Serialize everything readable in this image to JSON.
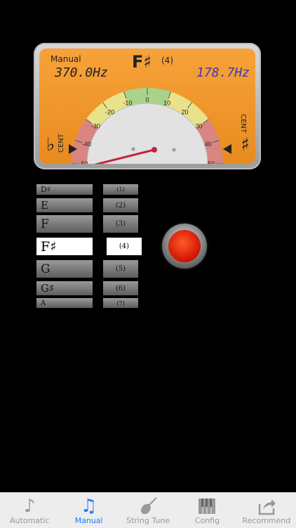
{
  "meter": {
    "mode": "Manual",
    "ref_freq": "370.0",
    "meas_freq": "178.7",
    "hz_unit": "Hz",
    "note": "F♯",
    "octave": "(4)",
    "flat_symbol": "♭",
    "sharp_symbol": "♯",
    "cent_label": "CENT",
    "ticks": [
      "-50",
      "-40",
      "-30",
      "-20",
      "-10",
      "0",
      "10",
      "20",
      "30",
      "40",
      "50"
    ],
    "needle_cents": -50
  },
  "note_wheel": {
    "items": [
      "D♯",
      "E",
      "F",
      "F♯",
      "G",
      "G♯",
      "A"
    ],
    "selected": "F♯"
  },
  "octave_wheel": {
    "items": [
      "(1)",
      "(2)",
      "(3)",
      "(4)",
      "(5)",
      "(6)",
      "(7)"
    ],
    "selected": "(4)"
  },
  "colors": {
    "tab_active": "#1b7cff",
    "tab_inactive": "#999999",
    "meter_face": "#f19a2c",
    "measured_freq": "#3b3bb6"
  },
  "tabs": [
    {
      "label": "Automatic",
      "icon": "music-note-icon",
      "active": false
    },
    {
      "label": "Manual",
      "icon": "music-notes-icon",
      "active": true
    },
    {
      "label": "String Tune",
      "icon": "violin-icon",
      "active": false
    },
    {
      "label": "Config",
      "icon": "keyboard-icon",
      "active": false
    },
    {
      "label": "Recommend",
      "icon": "share-icon",
      "active": false
    }
  ]
}
